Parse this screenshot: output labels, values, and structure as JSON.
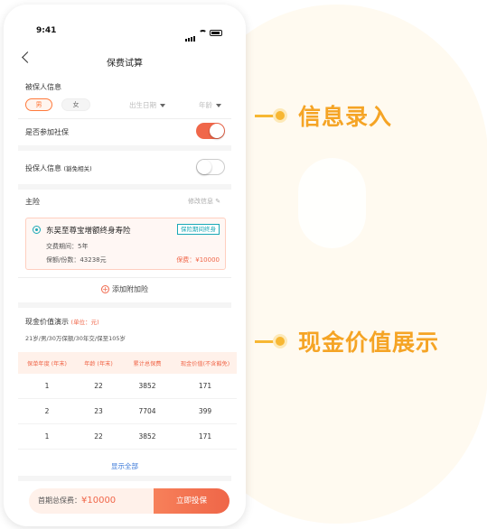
{
  "status": {
    "time": "9:41"
  },
  "nav": {
    "title": "保费试算"
  },
  "insured": {
    "section_label": "被保人信息",
    "gender_male": "男",
    "gender_female": "女",
    "birthdate_placeholder": "出生日期",
    "age_placeholder": "年龄",
    "social_security_label": "是否参加社保",
    "social_security_on": true
  },
  "policyholder": {
    "label": "投保人信息",
    "note": "(豁免相关)",
    "toggle_on": false
  },
  "main_insurance": {
    "label": "主险",
    "edit_label": "修改信息",
    "product_name": "东吴至尊宝增额终身寿险",
    "tag": "保险期间终身",
    "payment_period": "交费期间：5年",
    "sum_insured": "保额/份数：43238元",
    "premium": "保费：¥10000"
  },
  "add_rider": "添加附加险",
  "cash_value": {
    "title": "现金价值演示",
    "unit": "(单位：元)",
    "summary": "21岁/男/30万保额/30年交/保至105岁",
    "columns": [
      "保单年度 (年末)",
      "年龄 (年末)",
      "累计总保费",
      "现金价值(不含豁免)"
    ],
    "rows": [
      [
        "1",
        "22",
        "3852",
        "171"
      ],
      [
        "2",
        "23",
        "7704",
        "399"
      ],
      [
        "1",
        "22",
        "3852",
        "171"
      ]
    ],
    "show_all": "显示全部"
  },
  "bottom": {
    "total_label": "首期总保费：",
    "total_amount": "¥10000",
    "buy_button": "立即投保"
  },
  "annotations": {
    "info_entry": "信息录入",
    "cash_value_display": "现金价值展示"
  },
  "colors": {
    "accent": "#f0674a",
    "annotation": "#f5a425",
    "link": "#3a78d8",
    "tag": "#19a8b6"
  }
}
